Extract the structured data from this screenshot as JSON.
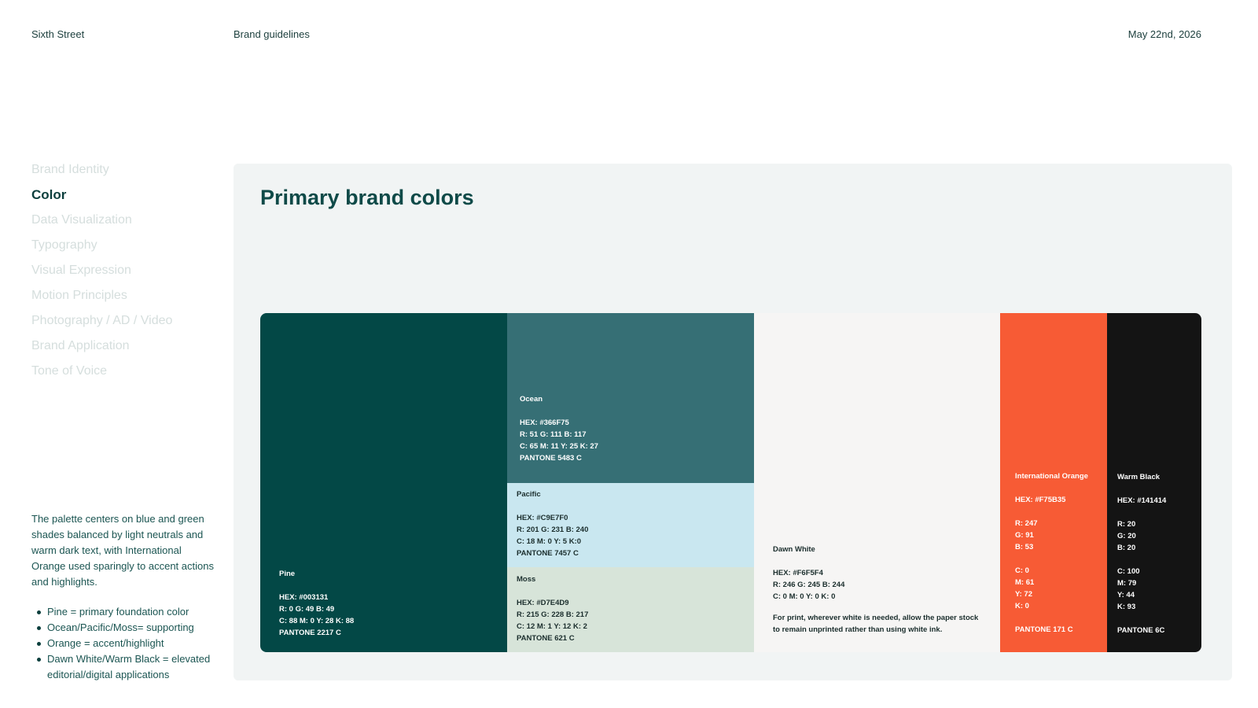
{
  "header": {
    "brand": "Sixth Street",
    "title": "Brand guidelines",
    "date": "May 22nd, 2026"
  },
  "sidebar": {
    "items": [
      {
        "label": "Brand Identity",
        "active": false
      },
      {
        "label": "Color",
        "active": true
      },
      {
        "label": "Data Visualization",
        "active": false
      },
      {
        "label": "Typography",
        "active": false
      },
      {
        "label": "Visual Expression",
        "active": false
      },
      {
        "label": "Motion Principles",
        "active": false
      },
      {
        "label": "Photography / AD / Video",
        "active": false
      },
      {
        "label": "Brand Application",
        "active": false
      },
      {
        "label": "Tone of Voice",
        "active": false
      }
    ],
    "intro": "The palette centers on blue and green shades balanced by light neutrals and warm dark text, with International Orange used sparingly to accent actions and highlights.",
    "bullets": [
      "Pine = primary foundation color",
      "Ocean/Pacific/Moss= supporting",
      "Orange = accent/highlight",
      "Dawn White/Warm Black = elevated editorial/digital applications"
    ]
  },
  "panel": {
    "title": "Primary brand colors"
  },
  "colors": {
    "pine": {
      "name": "Pine",
      "hex": "HEX: #003131",
      "rgb": "R: 0 G: 49 B: 49",
      "cmyk": "C: 88  M: 0  Y: 28  K: 88",
      "pantone": "PANTONE 2217 C",
      "swatch": "#034846"
    },
    "ocean": {
      "name": "Ocean",
      "hex": "HEX: #366F75",
      "rgb": "R: 51 G: 111  B: 117",
      "cmyk": "C: 65 M: 11  Y: 25  K: 27",
      "pantone": "PANTONE 5483 C",
      "swatch": "#366f75"
    },
    "pacific": {
      "name": "Pacific",
      "hex": "HEX: #C9E7F0",
      "rgb": "R: 201 G: 231  B: 240",
      "cmyk": "C: 18  M: 0  Y: 5  K:0",
      "pantone": "PANTONE 7457 C",
      "swatch": "#c9e7f0"
    },
    "moss": {
      "name": "Moss",
      "hex": "HEX: #D7E4D9",
      "rgb": "R: 215 G: 228  B: 217",
      "cmyk": "C: 12  M: 1  Y: 12 K: 2",
      "pantone": "PANTONE 621 C",
      "swatch": "#d7e4d9"
    },
    "dawn_white": {
      "name": "Dawn White",
      "hex": "HEX: #F6F5F4",
      "rgb": "R: 246 G: 245 B: 244",
      "cmyk": "C: 0  M: 0  Y: 0  K: 0",
      "note": "For print, wherever white is needed, allow the paper stock to remain unprinted rather than using white ink.",
      "swatch": "#f6f5f4"
    },
    "international_orange": {
      "name": "International Orange",
      "hex": "HEX: #F75B35",
      "r": "R: 247",
      "g": "G: 91",
      "b": "B: 53",
      "c": "C: 0",
      "m": "M: 61",
      "y": "Y: 72",
      "k": "K: 0",
      "pantone": "PANTONE 171 C",
      "swatch": "#f75b35"
    },
    "warm_black": {
      "name": "Warm Black",
      "hex": "HEX: #141414",
      "r": "R: 20",
      "g": "G: 20",
      "b": "B: 20",
      "c": "C: 100",
      "m": "M: 79",
      "y": "Y: 44",
      "k": "K: 93",
      "pantone": "PANTONE 6C",
      "swatch": "#141414"
    }
  }
}
